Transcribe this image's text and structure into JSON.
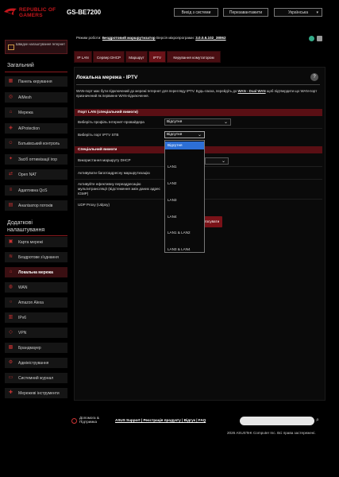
{
  "header": {
    "brand_line1": "REPUBLIC OF",
    "brand_line2": "GAMERS",
    "model": "GS-BE7200",
    "logout": "Вихід з системи",
    "reboot": "Перезавантажити",
    "language": "Українська"
  },
  "sidebar": {
    "quick_setup": "Швидке налаштування Інтернет",
    "general_title": "Загальний",
    "general_items": [
      {
        "label": "Панель керування",
        "icon": "dashboard-icon"
      },
      {
        "label": "AiMesh",
        "icon": "aimesh-icon"
      },
      {
        "label": "Мережа",
        "icon": "network-icon"
      },
      {
        "label": "AiProtection",
        "icon": "shield-icon"
      },
      {
        "label": "Батьківський контроль",
        "icon": "parental-icon"
      },
      {
        "label": "Засіб оптимізації ігор",
        "icon": "game-icon"
      },
      {
        "label": "Open NAT",
        "icon": "nat-icon"
      },
      {
        "label": "Адаптивна QoS",
        "icon": "qos-icon"
      },
      {
        "label": "Аналізатор потоків",
        "icon": "traffic-icon"
      }
    ],
    "advanced_title_1": "Додаткові",
    "advanced_title_2": "налаштування",
    "advanced_items": [
      {
        "label": "Карта мережі",
        "icon": "map-icon"
      },
      {
        "label": "Бездротове з'єднання",
        "icon": "wireless-icon"
      },
      {
        "label": "Локальна мережа",
        "icon": "home-icon"
      },
      {
        "label": "WAN",
        "icon": "globe-icon"
      },
      {
        "label": "Amazon Alexa",
        "icon": "alexa-icon"
      },
      {
        "label": "IPv6",
        "icon": "ipv6-icon"
      },
      {
        "label": "VPN",
        "icon": "vpn-icon"
      },
      {
        "label": "Брандмауер",
        "icon": "firewall-icon"
      },
      {
        "label": "Адміністрування",
        "icon": "admin-icon"
      },
      {
        "label": "Системний журнал",
        "icon": "log-icon"
      },
      {
        "label": "Мережеві інструменти",
        "icon": "tools-icon"
      }
    ]
  },
  "status": {
    "mode_label": "Режим роботи:",
    "mode_value": "Бездротовий маршрутизатор",
    "fw_label": "Версія мікропрограми:",
    "fw_value": "3.0.0.6.102_38062"
  },
  "tabs": [
    "IP LAN",
    "Сервер DHCP",
    "Маршрут",
    "IPTV",
    "Керування комутатором"
  ],
  "panel": {
    "title": "Локальна мережа - IPTV",
    "desc_1": "WAN-порт має бути підключений до мережі Інтернет для перегляду IPTV. Будь-ласка, перейдіть до",
    "desc_link": "WAN - Dual WAN",
    "desc_2": "щоб підтвердити що WAN-порт призначений як первинне WAN-підключення.",
    "section_lan": "Порт LAN (спеціальний вимоги)",
    "profile_label": "Виберіть профіль Інтернет-провайдера",
    "profile_value": "Відсутня",
    "stb_label": "Виберіть порт IPTV STB",
    "stb_value": "Відсутня",
    "section_special": "Спеціальний вимоги",
    "dhcp_label": "Використання маршруту DHCP",
    "multicast_label": "Активувати багатоадресну маршрутизацію",
    "igmp_label": "Активуйте ефективну переадресацію мультитрансляції (відстеження змін даних адрес IGMP)",
    "udp_label": "UDP Proxy (Udpxy)",
    "apply": "Застосувати"
  },
  "dropdown": {
    "options": [
      "Відсутня",
      "LAN1",
      "LAN2",
      "LAN3",
      "LAN4",
      "LAN1 & LAN2",
      "LAN3 & LAN4"
    ],
    "selected": "Відсутня"
  },
  "footer": {
    "help": "Допомога & Підтримка",
    "links": "ASUS Support | Реєстрація продукту | Відгук | FAQ",
    "copyright": "2026 ASUSTeK Computer Inc. Всі права застережені."
  },
  "colors": {
    "accent": "#c4161c",
    "selected_option": "#2d6fd6"
  }
}
